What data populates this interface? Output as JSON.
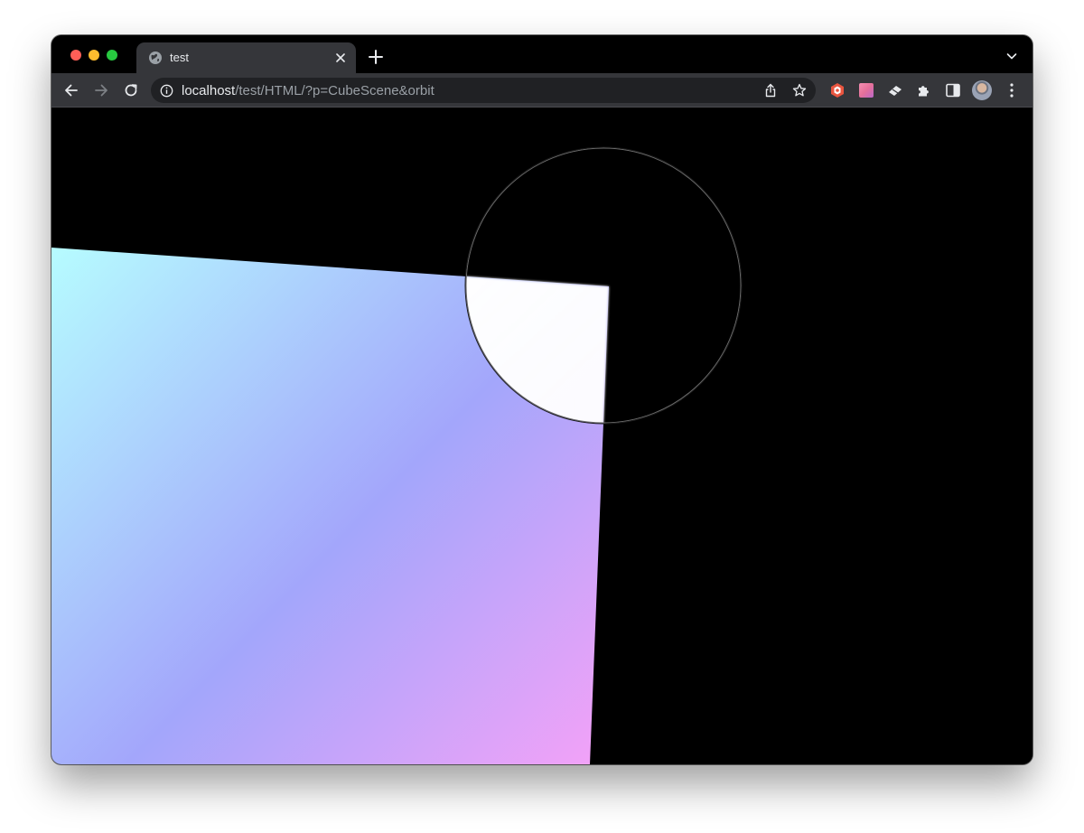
{
  "browser": {
    "tab": {
      "title": "test",
      "favicon": "globe-icon"
    },
    "address_bar": {
      "host": "localhost",
      "path": "/test/HTML/?p=CubeScene&orbit"
    },
    "icons": {
      "back": "arrow-left-icon",
      "forward": "arrow-right-icon",
      "reload": "reload-icon",
      "site_info": "info-icon",
      "share": "share-icon",
      "bookmark": "star-icon",
      "extensions": "puzzle-icon",
      "side_panel": "side-panel-icon",
      "menu": "kebab-menu-icon",
      "new_tab": "plus-icon",
      "tab_search": "chevron-down-icon"
    },
    "colors": {
      "chrome_frame": "#000000",
      "toolbar": "#35363a",
      "omnibox": "#202124",
      "text_primary": "#e8eaed",
      "text_secondary": "#9aa0a6"
    }
  },
  "scene": {
    "background": "#000000",
    "gradient_colors": [
      "#b6fcff",
      "#a3a6fb",
      "#f2a2f8"
    ],
    "highlight_color": "#ffffff"
  }
}
